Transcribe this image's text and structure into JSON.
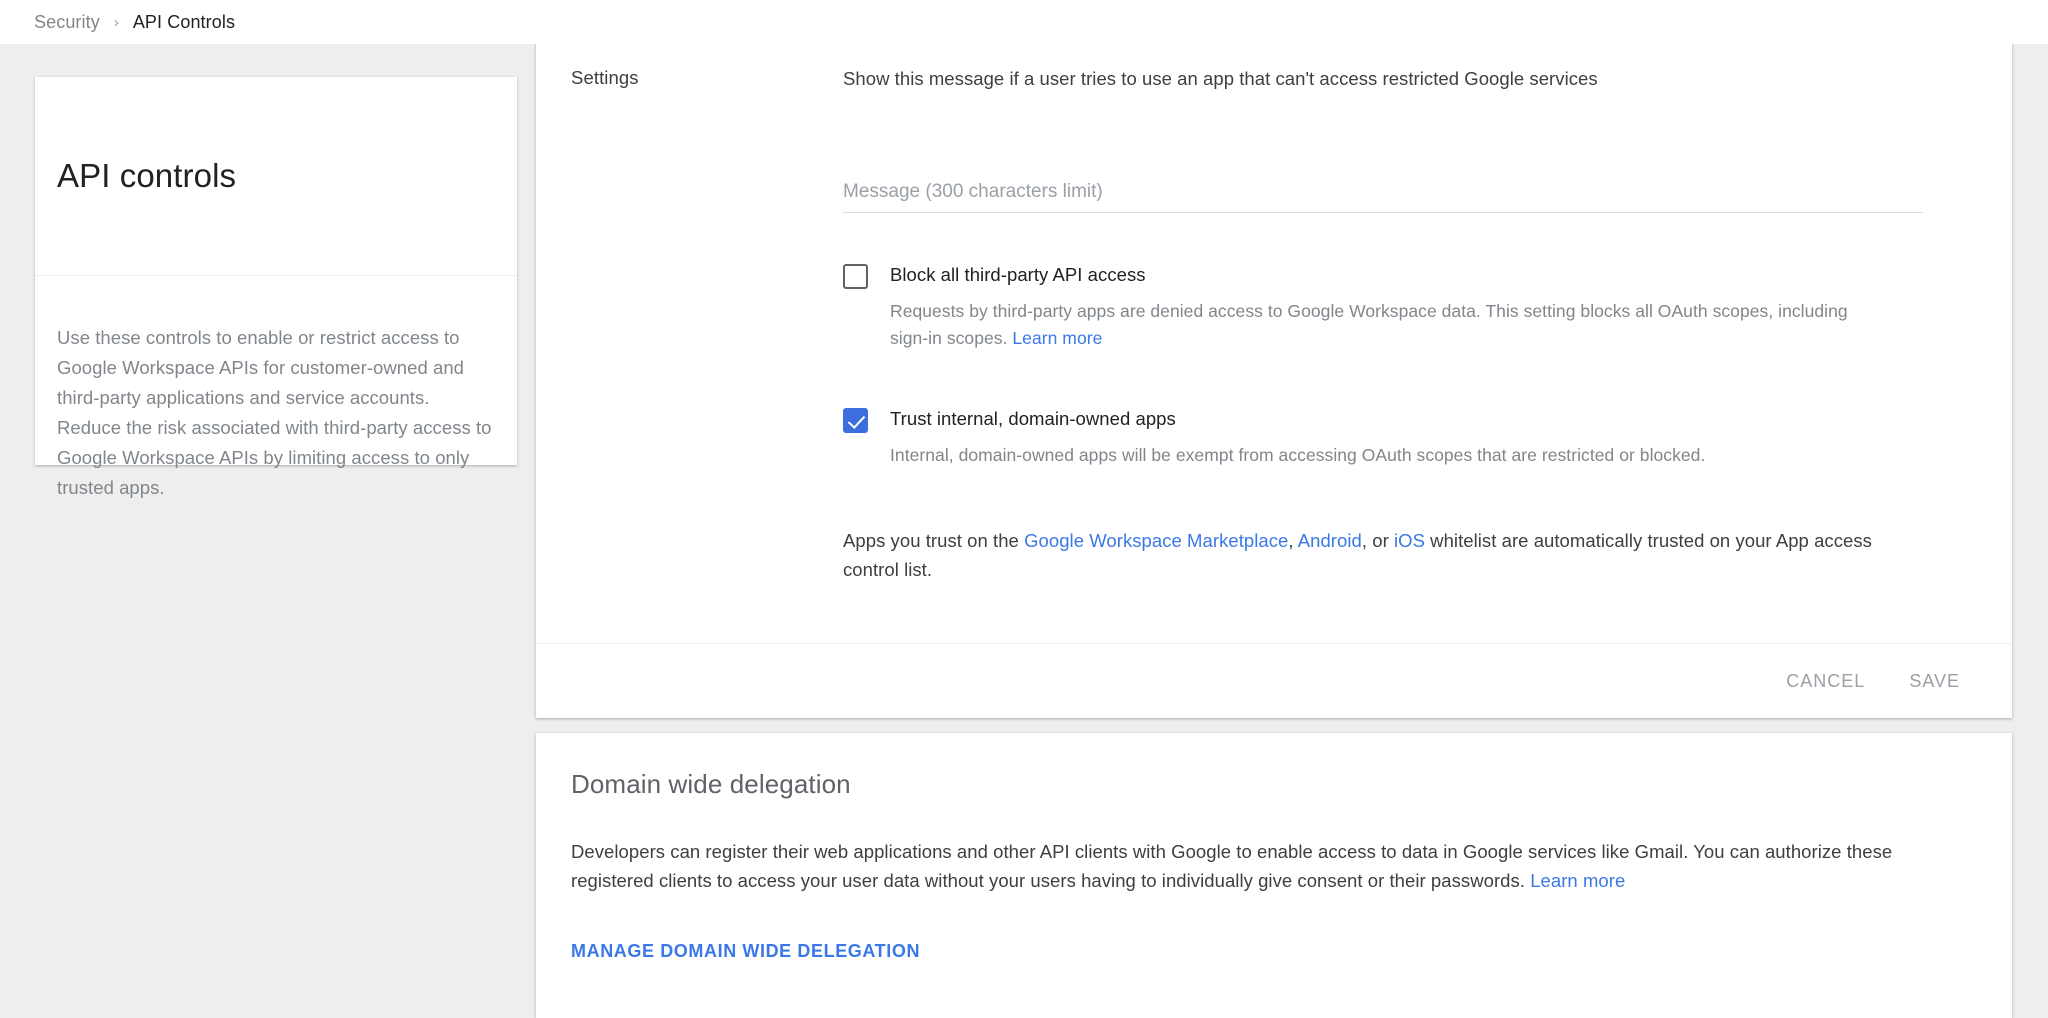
{
  "breadcrumb": {
    "parent": "Security",
    "separator": "›",
    "current": "API Controls"
  },
  "info_card": {
    "title": "API controls",
    "description": "Use these controls to enable or restrict access to Google Workspace APIs for customer-owned and third-party applications and service accounts. Reduce the risk associated with third-party access to Google Workspace APIs by limiting access to only trusted apps."
  },
  "settings": {
    "section_label": "Settings",
    "lead_text": "Show this message if a user tries to use an app that can't access restricted Google services",
    "message_field": {
      "placeholder": "Message (300 characters limit)",
      "value": ""
    },
    "checkboxes": [
      {
        "label": "Block all third-party API access",
        "checked": false,
        "description_before_link": "Requests by third-party apps are denied access to Google Workspace data. This setting blocks all OAuth scopes, including sign-in scopes. ",
        "link": "Learn more"
      },
      {
        "label": "Trust internal, domain-owned apps",
        "checked": true,
        "description_before_link": "Internal, domain-owned apps will be exempt from accessing OAuth scopes that are restricted or blocked.",
        "link": ""
      }
    ],
    "trust_note": {
      "part1": "Apps you trust on the ",
      "link1": "Google Workspace Marketplace",
      "part2": ", ",
      "link2": "Android",
      "part3": ", or ",
      "link3": "iOS",
      "part4": " whitelist are automatically trusted on your App access control list."
    },
    "cancel_label": "CANCEL",
    "save_label": "SAVE"
  },
  "delegation": {
    "title": "Domain wide delegation",
    "text_before_link": "Developers can register their web applications and other API clients with Google to enable access to data in Google services like Gmail. You can authorize these registered clients to access your user data without your users having to individually give consent or their passwords. ",
    "learn_more": "Learn more",
    "manage_button": "MANAGE DOMAIN WIDE DELEGATION"
  },
  "colors": {
    "accent_blue": "#3b78e7",
    "checkbox_blue": "#3c6ede",
    "page_background": "#eeeeee",
    "card_background": "#ffffff",
    "primary_text": "#3c4043",
    "secondary_text": "#80868b"
  }
}
